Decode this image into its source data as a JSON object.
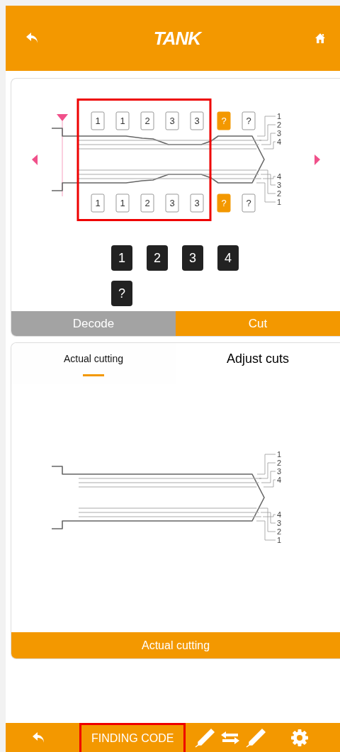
{
  "header": {
    "title": "TANK"
  },
  "decoder": {
    "highlighted": true,
    "top_cuts": [
      {
        "label": "1",
        "selected": false
      },
      {
        "label": "1",
        "selected": false
      },
      {
        "label": "2",
        "selected": false
      },
      {
        "label": "3",
        "selected": false
      },
      {
        "label": "3",
        "selected": false
      },
      {
        "label": "?",
        "selected": true
      },
      {
        "label": "?",
        "selected": false
      }
    ],
    "bottom_cuts": [
      {
        "label": "1",
        "selected": false
      },
      {
        "label": "1",
        "selected": false
      },
      {
        "label": "2",
        "selected": false
      },
      {
        "label": "3",
        "selected": false
      },
      {
        "label": "3",
        "selected": false
      },
      {
        "label": "?",
        "selected": true
      },
      {
        "label": "?",
        "selected": false
      }
    ],
    "top_depth_labels": [
      "1",
      "2",
      "3",
      "4"
    ],
    "bottom_depth_labels": [
      "4",
      "3",
      "2",
      "1"
    ],
    "depth_buttons": [
      "1",
      "2",
      "3",
      "4",
      "?"
    ],
    "mode_tabs": [
      {
        "label": "Decode",
        "selected": false
      },
      {
        "label": "Cut",
        "selected": true
      }
    ]
  },
  "cutting": {
    "tabs": [
      {
        "label": "Actual cutting",
        "selected": true
      },
      {
        "label": "Adjust cuts",
        "selected": false
      }
    ],
    "top_depth_labels": [
      "1",
      "2",
      "3",
      "4"
    ],
    "bottom_depth_labels": [
      "4",
      "3",
      "2",
      "1"
    ],
    "action_button": "Actual cutting"
  },
  "bottom_bar": {
    "finding_code": "FINDING CODE",
    "highlighted": true
  }
}
